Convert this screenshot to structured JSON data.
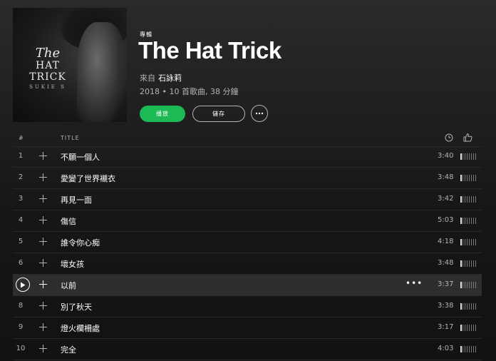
{
  "album": {
    "type_label": "專輯",
    "title": "The Hat Trick",
    "by_prefix": "來自",
    "artist": "石詠莉",
    "meta": "2018 • 10 首歌曲, 38 分鐘",
    "cover_text": {
      "line1": "The",
      "line2": "HAT TRICK",
      "line3": "SUKIE S"
    }
  },
  "actions": {
    "play_label": "播放",
    "save_label": "儲存",
    "more_label": "•••"
  },
  "table": {
    "col_number": "#",
    "col_title": "TITLE",
    "clock_icon": "clock-icon",
    "thumb_icon": "thumbs-up-icon",
    "tracks": [
      {
        "number": "1",
        "title": "不願一個人",
        "duration": "3:40"
      },
      {
        "number": "2",
        "title": "愛變了世界襯衣",
        "duration": "3:48"
      },
      {
        "number": "3",
        "title": "再見一面",
        "duration": "3:42"
      },
      {
        "number": "4",
        "title": "傷信",
        "duration": "5:03"
      },
      {
        "number": "5",
        "title": "誰令你心痴",
        "duration": "4:18"
      },
      {
        "number": "6",
        "title": "壞女孩",
        "duration": "3:48"
      },
      {
        "number": "7",
        "title": "以前",
        "duration": "3:37"
      },
      {
        "number": "8",
        "title": "別了秋天",
        "duration": "3:38"
      },
      {
        "number": "9",
        "title": "燈火欄柵處",
        "duration": "3:17"
      },
      {
        "number": "10",
        "title": "完全",
        "duration": "4:03"
      }
    ],
    "hovered_row": "7",
    "row_more_label": "•••"
  },
  "colors": {
    "accent": "#1db954",
    "background": "#121212",
    "divider": "#282828",
    "muted_text": "#b3b3b3"
  }
}
